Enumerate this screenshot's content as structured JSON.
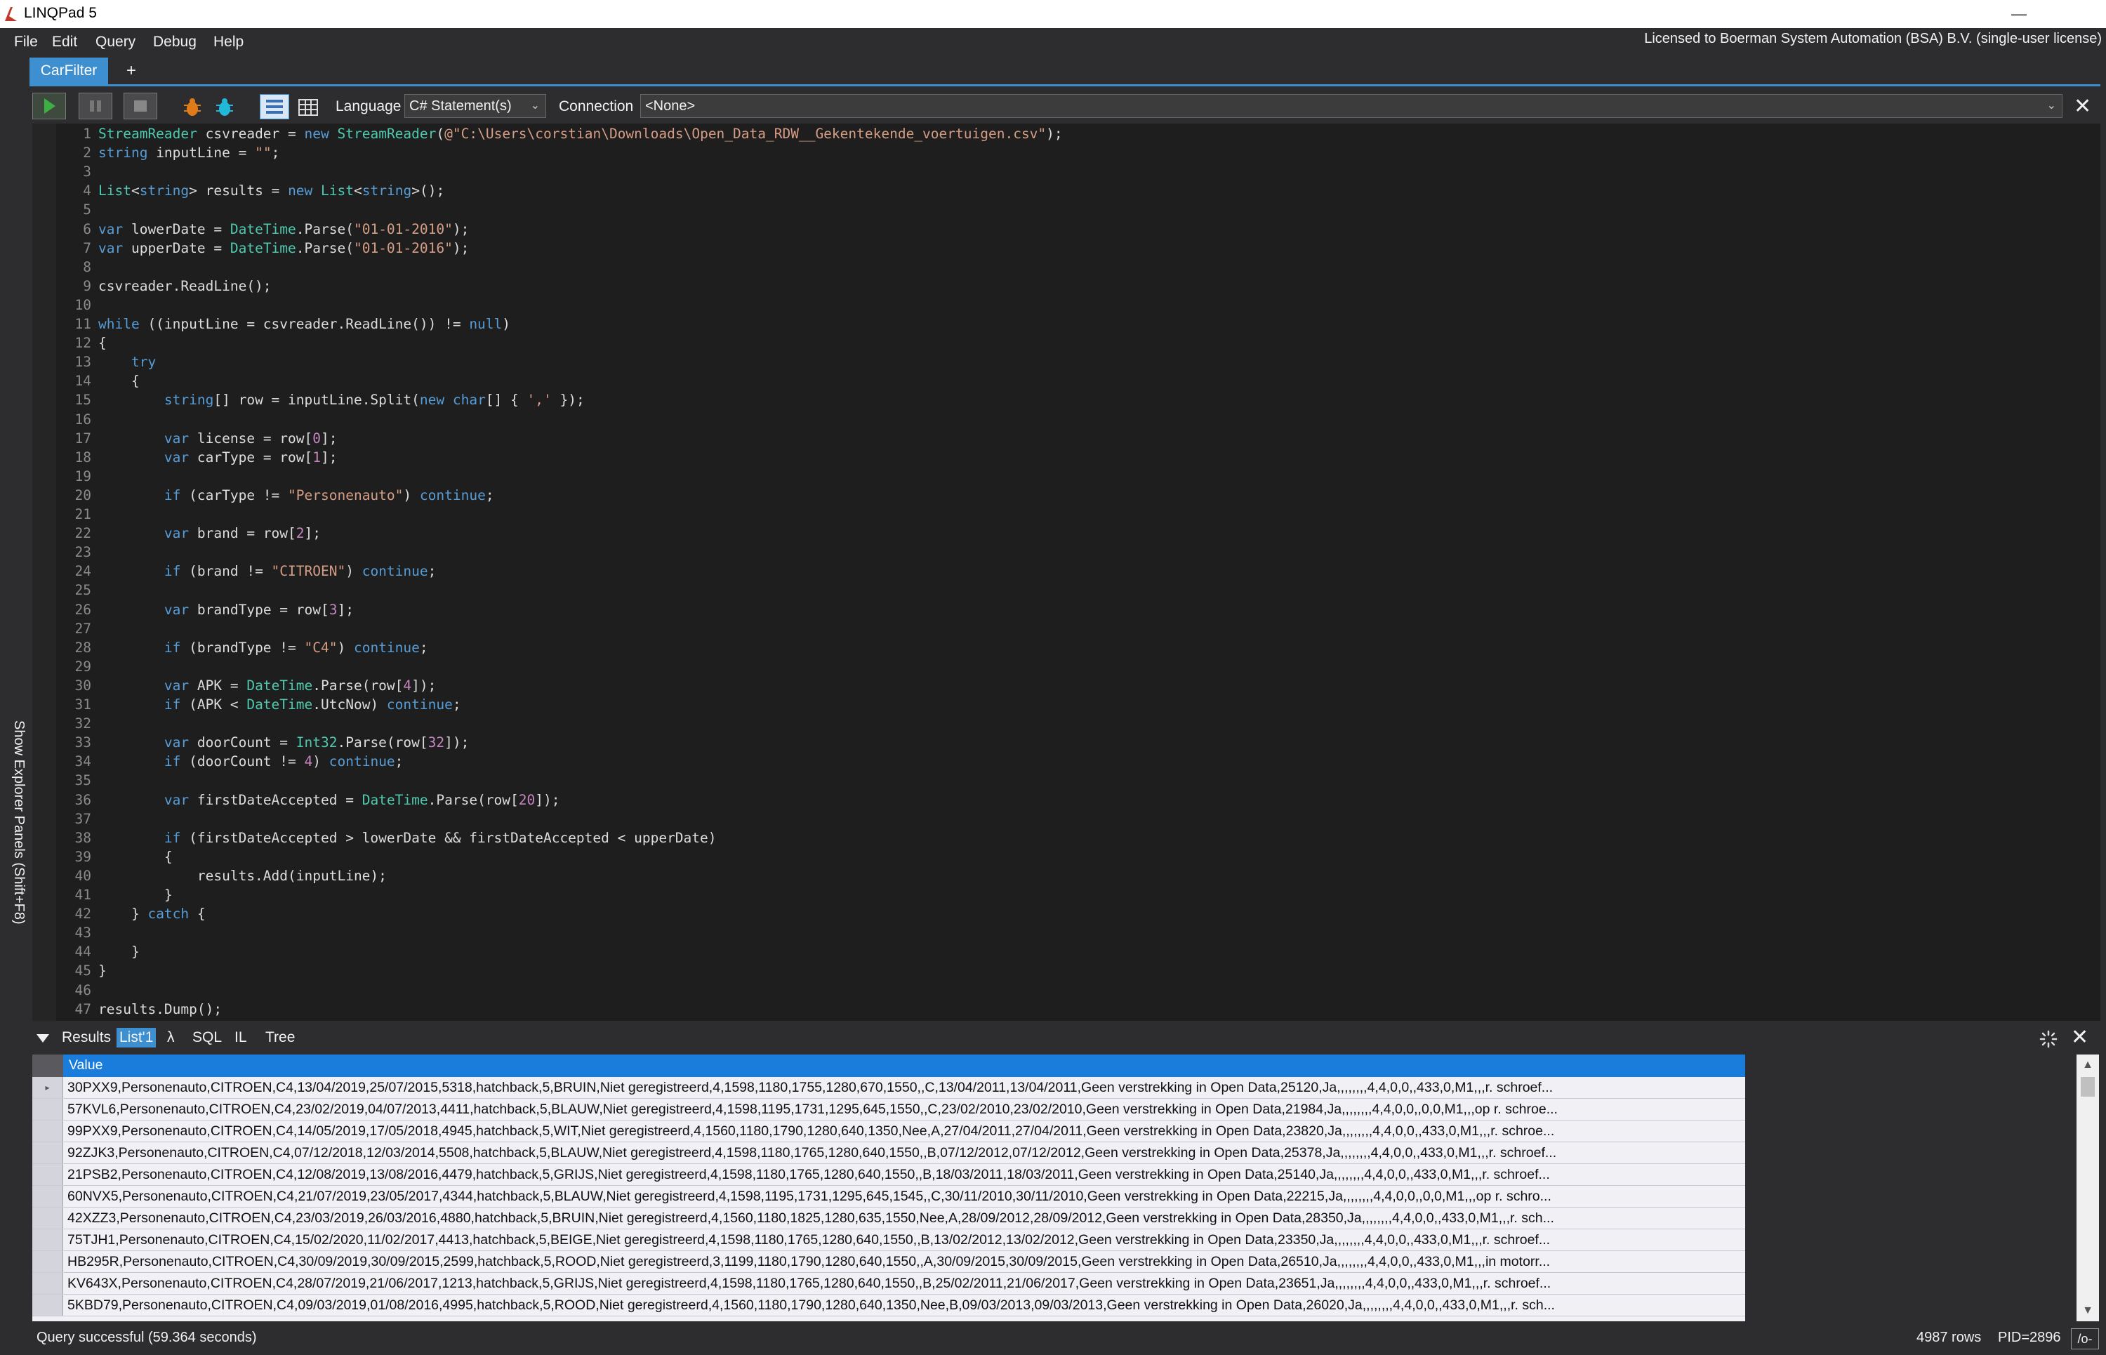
{
  "window": {
    "title": "LINQPad 5",
    "minimize": "—",
    "restore": "❐",
    "close": "✕"
  },
  "menu": [
    "File",
    "Edit",
    "Query",
    "Debug",
    "Help"
  ],
  "license": "Licensed to Boerman System Automation (BSA) B.V. (single-user license)",
  "tabs": {
    "active": "CarFilter",
    "add": "+"
  },
  "toolbar": {
    "language_label": "Language",
    "language_value": "C# Statement(s)",
    "connection_label": "Connection",
    "connection_value": "<None>",
    "close": "✕"
  },
  "side_panel": "Show Explorer Panels  (Shift+F8)",
  "code": [
    "StreamReader csvreader = new StreamReader(@\"C:\\Users\\corstian\\Downloads\\Open_Data_RDW__Gekentekende_voertuigen.csv\");",
    "string inputLine = \"\";",
    "",
    "List<string> results = new List<string>();",
    "",
    "var lowerDate = DateTime.Parse(\"01-01-2010\");",
    "var upperDate = DateTime.Parse(\"01-01-2016\");",
    "",
    "csvreader.ReadLine();",
    "",
    "while ((inputLine = csvreader.ReadLine()) != null)",
    "{",
    "    try",
    "    {",
    "        string[] row = inputLine.Split(new char[] { ',' });",
    "",
    "        var license = row[0];",
    "        var carType = row[1];",
    "",
    "        if (carType != \"Personenauto\") continue;",
    "",
    "        var brand = row[2];",
    "",
    "        if (brand != \"CITROEN\") continue;",
    "",
    "        var brandType = row[3];",
    "",
    "        if (brandType != \"C4\") continue;",
    "",
    "        var APK = DateTime.Parse(row[4]);",
    "        if (APK < DateTime.UtcNow) continue;",
    "",
    "        var doorCount = Int32.Parse(row[32]);",
    "        if (doorCount != 4) continue;",
    "",
    "        var firstDateAccepted = DateTime.Parse(row[20]);",
    "",
    "        if (firstDateAccepted > lowerDate && firstDateAccepted < upperDate)",
    "        {",
    "            results.Add(inputLine);",
    "        }",
    "    } catch {",
    "",
    "    }",
    "}",
    "",
    "results.Dump();"
  ],
  "results_tabs": [
    "Results",
    "List'1",
    "λ",
    "SQL",
    "IL",
    "Tree"
  ],
  "grid": {
    "header": "Value",
    "rows": [
      "30PXX9,Personenauto,CITROEN,C4,13/04/2019,25/07/2015,5318,hatchback,5,BRUIN,Niet geregistreerd,4,1598,1180,1755,1280,670,1550,,C,13/04/2011,13/04/2011,Geen verstrekking in Open Data,25120,Ja,,,,,,,,4,4,0,0,,433,0,M1,,,r. schroef...",
      "57KVL6,Personenauto,CITROEN,C4,23/02/2019,04/07/2013,4411,hatchback,5,BLAUW,Niet geregistreerd,4,1598,1195,1731,1295,645,1550,,C,23/02/2010,23/02/2010,Geen verstrekking in Open Data,21984,Ja,,,,,,,,4,4,0,0,,0,0,M1,,,op r. schroe...",
      "99PXX9,Personenauto,CITROEN,C4,14/05/2019,17/05/2018,4945,hatchback,5,WIT,Niet geregistreerd,4,1560,1180,1790,1280,640,1350,Nee,A,27/04/2011,27/04/2011,Geen verstrekking in Open Data,23820,Ja,,,,,,,,4,4,0,0,,433,0,M1,,,r. schroe...",
      "92ZJK3,Personenauto,CITROEN,C4,07/12/2018,12/03/2014,5508,hatchback,5,BLAUW,Niet geregistreerd,4,1598,1180,1765,1280,640,1550,,B,07/12/2012,07/12/2012,Geen verstrekking in Open Data,25378,Ja,,,,,,,,4,4,0,0,,433,0,M1,,,r. schroef...",
      "21PSB2,Personenauto,CITROEN,C4,12/08/2019,13/08/2016,4479,hatchback,5,GRIJS,Niet geregistreerd,4,1598,1180,1765,1280,640,1550,,B,18/03/2011,18/03/2011,Geen verstrekking in Open Data,25140,Ja,,,,,,,,4,4,0,0,,433,0,M1,,,r. schroef...",
      "60NVX5,Personenauto,CITROEN,C4,21/07/2019,23/05/2017,4344,hatchback,5,BLAUW,Niet geregistreerd,4,1598,1195,1731,1295,645,1545,,C,30/11/2010,30/11/2010,Geen verstrekking in Open Data,22215,Ja,,,,,,,,4,4,0,0,,0,0,M1,,,op r. schro...",
      "42XZZ3,Personenauto,CITROEN,C4,23/03/2019,26/03/2016,4880,hatchback,5,BRUIN,Niet geregistreerd,4,1560,1180,1825,1280,635,1550,Nee,A,28/09/2012,28/09/2012,Geen verstrekking in Open Data,28350,Ja,,,,,,,,4,4,0,0,,433,0,M1,,,r. sch...",
      "75TJH1,Personenauto,CITROEN,C4,15/02/2020,11/02/2017,4413,hatchback,5,BEIGE,Niet geregistreerd,4,1598,1180,1765,1280,640,1550,,B,13/02/2012,13/02/2012,Geen verstrekking in Open Data,23350,Ja,,,,,,,,4,4,0,0,,433,0,M1,,,r. schroef...",
      "HB295R,Personenauto,CITROEN,C4,30/09/2019,30/09/2015,2599,hatchback,5,ROOD,Niet geregistreerd,3,1199,1180,1790,1280,640,1550,,A,30/09/2015,30/09/2015,Geen verstrekking in Open Data,26510,Ja,,,,,,,,4,4,0,0,,433,0,M1,,,in motorr...",
      "KV643X,Personenauto,CITROEN,C4,28/07/2019,21/06/2017,1213,hatchback,5,GRIJS,Niet geregistreerd,4,1598,1180,1765,1280,640,1550,,B,25/02/2011,21/06/2017,Geen verstrekking in Open Data,23651,Ja,,,,,,,,4,4,0,0,,433,0,M1,,,r. schroef...",
      "5KBD79,Personenauto,CITROEN,C4,09/03/2019,01/08/2016,4995,hatchback,5,ROOD,Niet geregistreerd,4,1560,1180,1790,1280,640,1350,Nee,B,09/03/2013,09/03/2013,Geen verstrekking in Open Data,26020,Ja,,,,,,,,4,4,0,0,,433,0,M1,,,r. sch..."
    ]
  },
  "status": {
    "message": "Query successful  (59.364 seconds)",
    "rows": "4987 rows",
    "pid": "PID=2896",
    "format": "/o-"
  },
  "colors": {
    "accent": "#3d8fd0",
    "editor_bg": "#1e1e1e",
    "chrome_bg": "#2d2d30",
    "keyword": "#569cd6",
    "type": "#4ec9b0",
    "string": "#d69d85"
  }
}
